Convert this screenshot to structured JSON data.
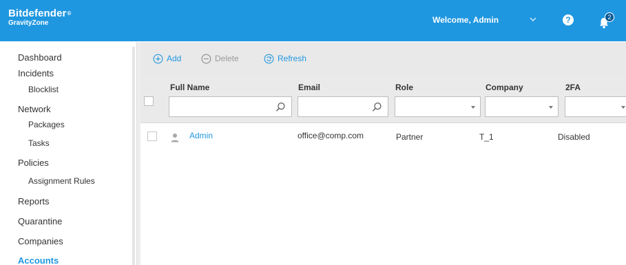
{
  "header": {
    "brand": "Bitdefender",
    "brand_sub": "GravityZone",
    "welcome": "Welcome, Admin",
    "help_glyph": "?",
    "notification_count": "2",
    "brand_color": "#1f97e0"
  },
  "sidebar": {
    "items": [
      {
        "label": "Dashboard"
      },
      {
        "label": "Incidents"
      },
      {
        "label": "Blocklist"
      },
      {
        "label": "Network"
      },
      {
        "label": "Packages"
      },
      {
        "label": "Tasks"
      },
      {
        "label": "Policies"
      },
      {
        "label": "Assignment Rules"
      },
      {
        "label": "Reports"
      },
      {
        "label": "Quarantine"
      },
      {
        "label": "Companies"
      },
      {
        "label": "Accounts"
      }
    ],
    "active": "Accounts"
  },
  "toolbar": {
    "add_label": "Add",
    "delete_label": "Delete",
    "refresh_label": "Refresh"
  },
  "table": {
    "columns": [
      "Full Name",
      "Email",
      "Role",
      "Company",
      "2FA"
    ],
    "rows": [
      {
        "full_name": "Admin",
        "email": "office@comp.com",
        "role": "Partner",
        "company": "T_1",
        "twofa": "Disabled"
      }
    ]
  },
  "icons": [
    "search-icon",
    "chevron-down-icon",
    "help-icon",
    "bell-icon",
    "add-icon",
    "delete-icon",
    "refresh-icon",
    "user-icon"
  ]
}
